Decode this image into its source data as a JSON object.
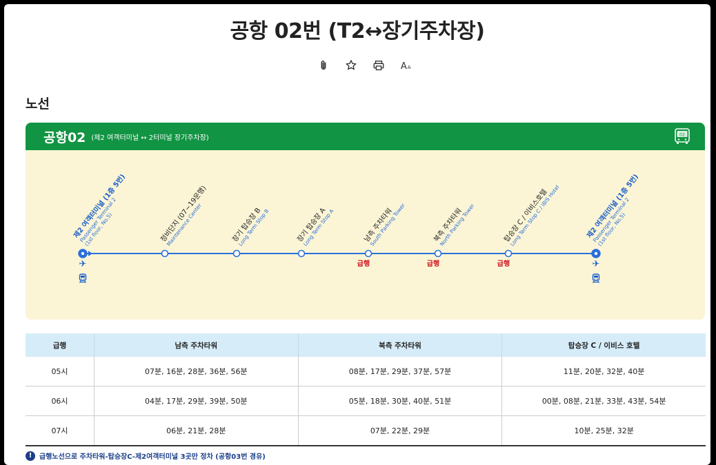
{
  "page": {
    "title": "공항 02번 (T2↔장기주차장)",
    "section_title": "노선",
    "toolbar": [
      {
        "name": "attachment-icon",
        "glyph": "attach"
      },
      {
        "name": "favorite-icon",
        "glyph": "star"
      },
      {
        "name": "print-icon",
        "glyph": "print"
      },
      {
        "name": "font-size-icon",
        "glyph": "Aa"
      }
    ]
  },
  "route": {
    "name": "공항02",
    "description": "(제2 여객터미널 ↔ 2터미널 장기주차장)",
    "badge": "02",
    "colors": {
      "header": "#119443",
      "line": "#2a6fdb",
      "express": "#d0121b",
      "panel": "#fbf5d6"
    },
    "express_label": "급행",
    "stops": [
      {
        "ko": "제2 여객터미널 (1층 5번)",
        "en1": "Passenger Terminal 2",
        "en2": "(1st floor, No.5)",
        "terminal": true,
        "express": false
      },
      {
        "ko": "정비단지 (07~19운행)",
        "en1": "Maintenance Center",
        "en2": "",
        "terminal": false,
        "express": false
      },
      {
        "ko": "장기 탑승장 B",
        "en1": "Long Term Stop B",
        "en2": "",
        "terminal": false,
        "express": false
      },
      {
        "ko": "장기 탑승장 A",
        "en1": "Long Term Stop A",
        "en2": "",
        "terminal": false,
        "express": false
      },
      {
        "ko": "남측 주차타워",
        "en1": "South Parking Tower",
        "en2": "",
        "terminal": false,
        "express": true
      },
      {
        "ko": "북측 주차타워",
        "en1": "North Parking Tower",
        "en2": "",
        "terminal": false,
        "express": true
      },
      {
        "ko": "탑승장 C / 이비스호텔",
        "en1": "Long Term Stop C / IBIS Hotel",
        "en2": "",
        "terminal": false,
        "express": true
      },
      {
        "ko": "제2 여객터미널 (1층 5번)",
        "en1": "Passenger Terminal 2",
        "en2": "(1st floor, No.5)",
        "terminal": true,
        "express": false
      }
    ]
  },
  "timetable": {
    "headers": [
      "급행",
      "남측 주차타워",
      "북측 주차타워",
      "탑승장 C / 이비스 호텔"
    ],
    "rows": [
      [
        "05시",
        "07분, 16분, 28분, 36분, 56분",
        "08분, 17분, 29분, 37분, 57분",
        "11분, 20분, 32분, 40분"
      ],
      [
        "06시",
        "04분, 17분, 29분, 39분, 50분",
        "05분, 18분, 30분, 40분, 51분",
        "00분, 08분, 21분, 33분, 43분, 54분"
      ],
      [
        "07시",
        "06분, 21분, 28분",
        "07분, 22분, 29분",
        "10분, 25분, 32분"
      ]
    ]
  },
  "note": "급행노선으로 주차타워-탑승장C-제2여객터미널 3곳만 정차 (공항03번 경유)"
}
